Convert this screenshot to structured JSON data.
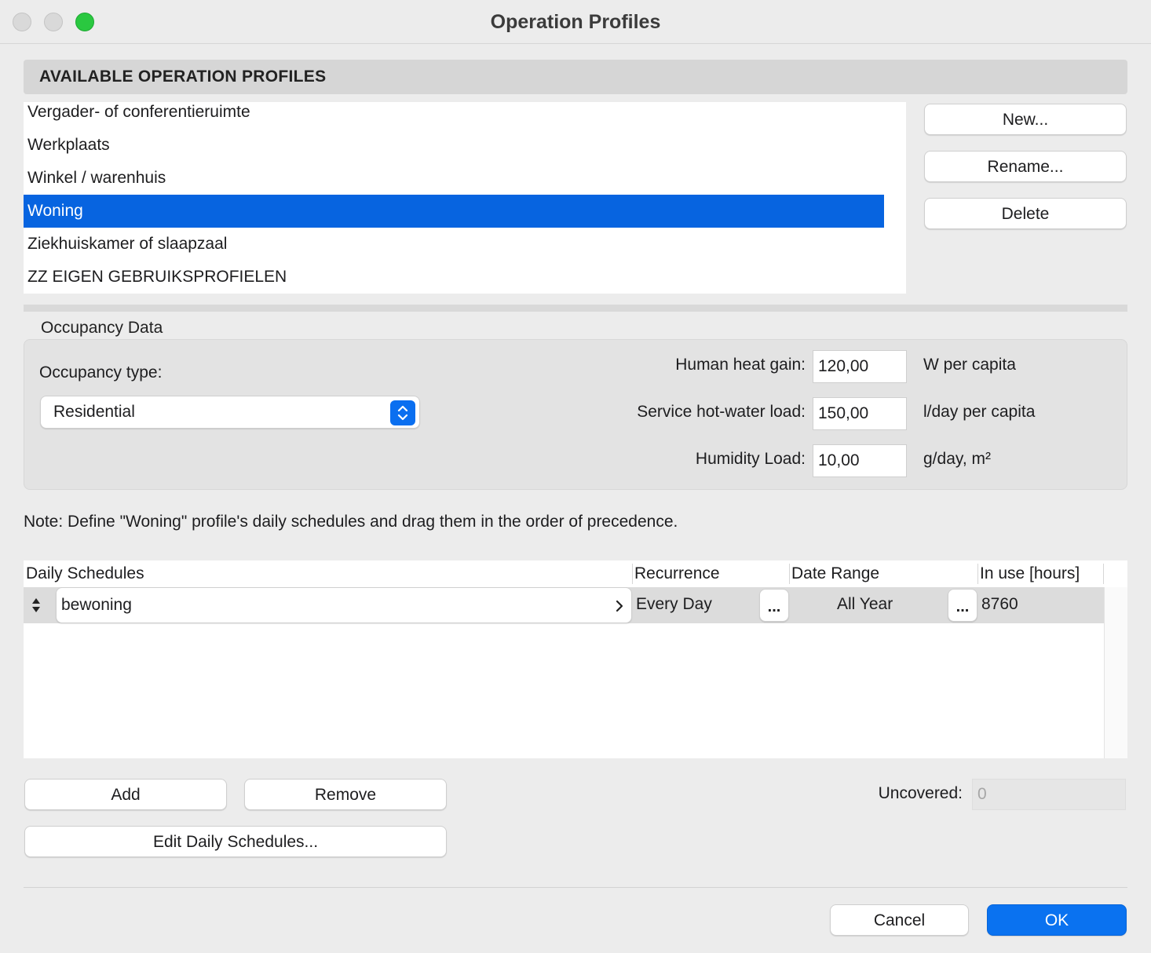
{
  "window": {
    "title": "Operation Profiles"
  },
  "profiles": {
    "header": "AVAILABLE OPERATION PROFILES",
    "items": [
      {
        "label": "Vergader- of conferentieruimte",
        "selected": false
      },
      {
        "label": "Werkplaats",
        "selected": false
      },
      {
        "label": "Winkel / warenhuis",
        "selected": false
      },
      {
        "label": "Woning",
        "selected": true
      },
      {
        "label": "Ziekhuiskamer of slaapzaal",
        "selected": false
      },
      {
        "label": "ZZ EIGEN GEBRUIKSPROFIELEN",
        "selected": false
      }
    ],
    "buttons": {
      "new": "New...",
      "rename": "Rename...",
      "delete": "Delete"
    }
  },
  "occupancy": {
    "group_title": "Occupancy Data",
    "type_label": "Occupancy type:",
    "type_value": "Residential",
    "heat_gain": {
      "label": "Human heat gain:",
      "value": "120,00",
      "unit": "W per capita"
    },
    "hot_water": {
      "label": "Service hot-water load:",
      "value": "150,00",
      "unit": "l/day per capita"
    },
    "humidity": {
      "label": "Humidity Load:",
      "value": "10,00",
      "unit": "g/day, m²"
    }
  },
  "note": "Note: Define \"Woning\" profile's daily schedules and drag them in the order of precedence.",
  "schedules": {
    "columns": {
      "daily": "Daily Schedules",
      "recurrence": "Recurrence",
      "date_range": "Date Range",
      "in_use": "In use [hours]"
    },
    "rows": [
      {
        "name": "bewoning",
        "recurrence": "Every Day",
        "date_range": "All Year",
        "in_use": "8760",
        "more": "..."
      }
    ]
  },
  "actions": {
    "add": "Add",
    "remove": "Remove",
    "edit_daily": "Edit Daily Schedules...",
    "uncovered_label": "Uncovered:",
    "uncovered_value": "0",
    "cancel": "Cancel",
    "ok": "OK"
  },
  "colors": {
    "accent": "#0a72f0",
    "selection": "#0764e0",
    "zoom_button": "#2ac840"
  }
}
